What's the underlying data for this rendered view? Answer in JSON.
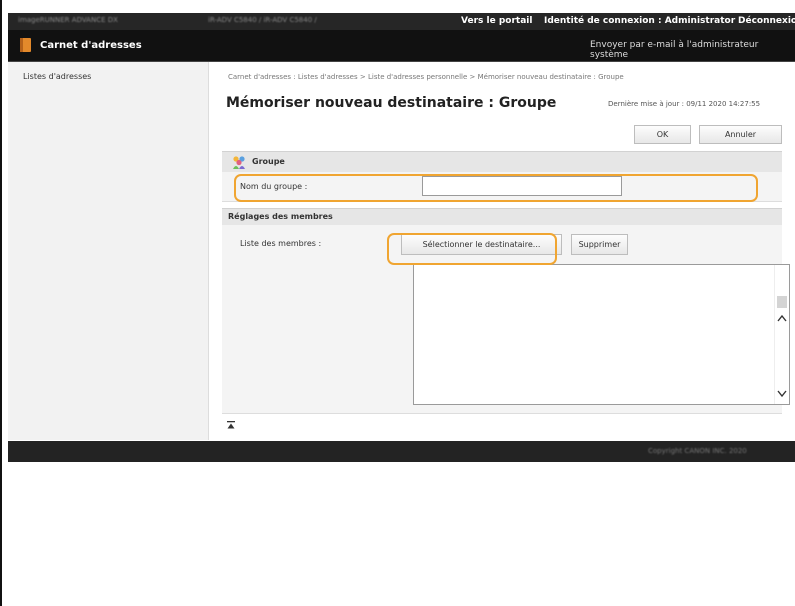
{
  "topbar": {
    "device_name": "imageRUNNER ADVANCE DX",
    "device_ip": "iR-ADV C5840 / iR-ADV C5840 /",
    "portal_link": "Vers le portail",
    "login_identity": "Identité de connexion :  Administrator",
    "logout_link": "Déconnexion"
  },
  "appbar": {
    "title": "Carnet d'adresses",
    "mail_link": "Envoyer par e-mail à l'administrateur système"
  },
  "sidebar": {
    "items": [
      {
        "label": "Listes d'adresses"
      }
    ]
  },
  "breadcrumb": {
    "items": [
      "Carnet d'adresses : Listes d'adresses",
      "Liste d'adresses personnelle",
      "Mémoriser nouveau destinataire : Groupe"
    ],
    "separator": " > "
  },
  "page": {
    "title": "Mémoriser nouveau destinataire : Groupe",
    "last_updated": "Dernière mise à jour : 09/11 2020 14:27:55",
    "ok_label": "OK",
    "cancel_label": "Annuler"
  },
  "group_section": {
    "heading": "Groupe",
    "name_label": "Nom du groupe :",
    "name_value": ""
  },
  "members_section": {
    "heading": "Réglages des membres",
    "list_label": "Liste des membres :",
    "select_button": "Sélectionner le destinataire...",
    "delete_button": "Supprimer",
    "members": []
  },
  "footer": {
    "copyright": "Copyright CANON INC. 2020"
  },
  "icons": {
    "address_book": "address-book-icon",
    "group": "group-icon",
    "scroll_up": "scroll-up-arrow-icon",
    "scroll_down": "scroll-down-arrow-icon",
    "back_to_top": "back-to-top-icon"
  },
  "colors": {
    "highlight": "#f0a531",
    "topbar": "#262626",
    "appbar": "#111111",
    "section_header": "#e6e6e6"
  }
}
